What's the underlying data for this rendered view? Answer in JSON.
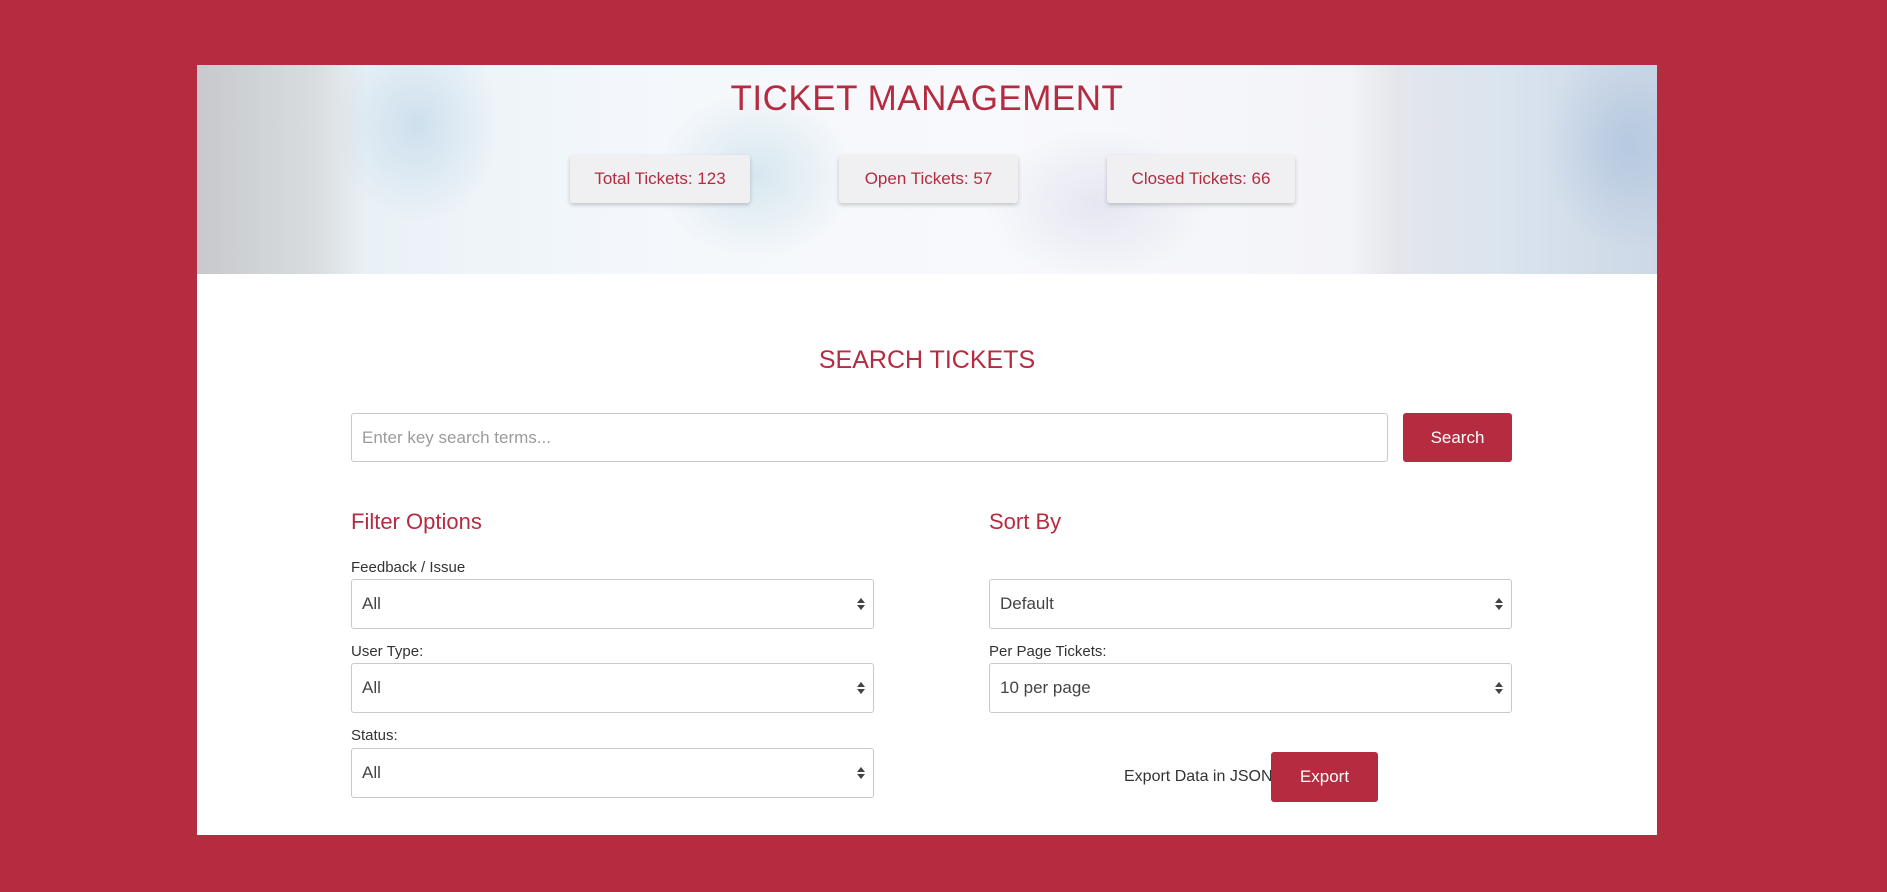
{
  "hero": {
    "title": "TICKET MANAGEMENT",
    "stats": [
      {
        "label": "Total Tickets: 123"
      },
      {
        "label": "Open Tickets: 57"
      },
      {
        "label": "Closed Tickets: 66"
      }
    ]
  },
  "search": {
    "title": "SEARCH TICKETS",
    "placeholder": "Enter key search terms...",
    "button": "Search"
  },
  "filters": {
    "title": "Filter Options",
    "feedback_label": "Feedback / Issue",
    "feedback_value": "All",
    "user_type_label": "User Type:",
    "user_type_value": "All",
    "status_label": "Status:",
    "status_value": "All"
  },
  "sort": {
    "title": "Sort By",
    "sort_value": "Default",
    "per_page_label": "Per Page Tickets:",
    "per_page_value": "10 per page"
  },
  "export": {
    "label": "Export Data in JSON",
    "button": "Export"
  },
  "colors": {
    "accent": "#b52b40",
    "background": "#b52b40",
    "card": "#ffffff"
  }
}
